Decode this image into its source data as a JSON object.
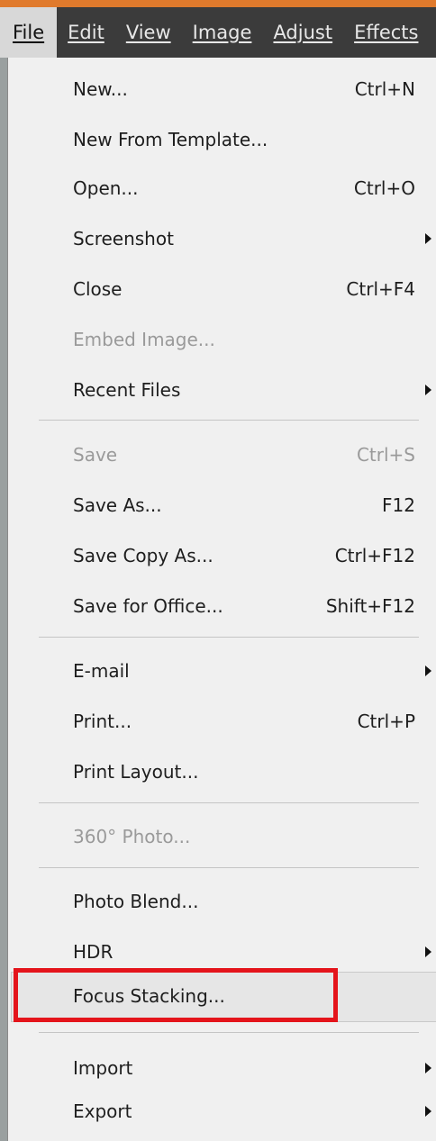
{
  "menubar": {
    "items": [
      {
        "label": "File"
      },
      {
        "label": "Edit"
      },
      {
        "label": "View"
      },
      {
        "label": "Image"
      },
      {
        "label": "Adjust"
      },
      {
        "label": "Effects"
      }
    ]
  },
  "file_menu": {
    "new": {
      "label": "New...",
      "shortcut": "Ctrl+N"
    },
    "new_from_template": {
      "label": "New From Template..."
    },
    "open": {
      "label": "Open...",
      "shortcut": "Ctrl+O"
    },
    "screenshot": {
      "label": "Screenshot"
    },
    "close": {
      "label": "Close",
      "shortcut": "Ctrl+F4"
    },
    "embed_image": {
      "label": "Embed Image..."
    },
    "recent_files": {
      "label": "Recent Files"
    },
    "save": {
      "label": "Save",
      "shortcut": "Ctrl+S"
    },
    "save_as": {
      "label": "Save As...",
      "shortcut": "F12"
    },
    "save_copy_as": {
      "label": "Save Copy As...",
      "shortcut": "Ctrl+F12"
    },
    "save_for_office": {
      "label": "Save for Office...",
      "shortcut": "Shift+F12"
    },
    "email": {
      "label": "E-mail"
    },
    "print": {
      "label": "Print...",
      "shortcut": "Ctrl+P"
    },
    "print_layout": {
      "label": "Print Layout..."
    },
    "photo_360": {
      "label": "360° Photo..."
    },
    "photo_blend": {
      "label": "Photo Blend..."
    },
    "hdr": {
      "label": "HDR"
    },
    "focus_stacking": {
      "label": "Focus Stacking..."
    },
    "import": {
      "label": "Import"
    },
    "export": {
      "label": "Export"
    }
  },
  "colors": {
    "menubar_bg": "#3b3b3b",
    "accent_strip": "#e07a2c",
    "highlight_box": "#e4141b",
    "disabled_text": "#9a9a9a"
  }
}
